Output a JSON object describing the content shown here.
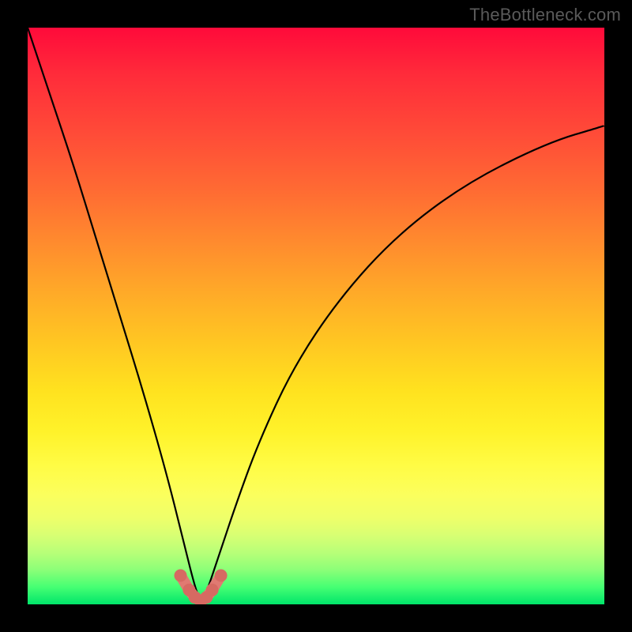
{
  "watermark": "TheBottleneck.com",
  "chart_data": {
    "type": "line",
    "title": "",
    "xlabel": "",
    "ylabel": "",
    "xlim": [
      0,
      100
    ],
    "ylim": [
      0,
      100
    ],
    "grid": false,
    "legend": false,
    "background": "vertical gradient red→orange→yellow→green (red high, green low)",
    "note": "Curve depicts bottleneck metric; minimum near x≈30 (optimal). Salmon markers highlight near-optimal region around the minimum.",
    "series": [
      {
        "name": "bottleneck-curve",
        "x": [
          0,
          4,
          8,
          12,
          16,
          20,
          24,
          27,
          29,
          30,
          31,
          33,
          36,
          40,
          46,
          54,
          64,
          76,
          90,
          100
        ],
        "y": [
          100,
          88,
          76,
          63,
          50,
          37,
          23,
          11,
          3,
          0.5,
          2,
          8,
          17,
          28,
          41,
          53,
          64,
          73,
          80,
          83
        ]
      }
    ],
    "highlight_region": {
      "name": "optimal-zone-markers",
      "x": [
        26.5,
        28.0,
        29.0,
        30.0,
        31.0,
        32.0,
        33.5
      ],
      "y": [
        5.0,
        2.5,
        1.2,
        0.6,
        1.2,
        2.5,
        5.0
      ]
    }
  },
  "colors": {
    "frame": "#000000",
    "curve": "#000000",
    "marker": "#e07a72",
    "gradient_top": "#ff0a3a",
    "gradient_bottom": "#00e56a"
  }
}
